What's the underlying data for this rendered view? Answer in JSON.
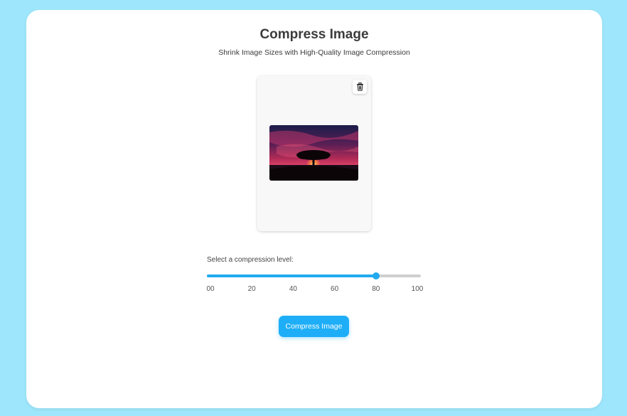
{
  "page": {
    "title": "Compress Image",
    "subtitle": "Shrink Image Sizes with High-Quality Image Compression"
  },
  "preview": {
    "delete_icon": "trash-icon",
    "image_subject": "tree silhouette at sunset"
  },
  "compression": {
    "label": "Select a compression level:",
    "value": 80,
    "min": 0,
    "max": 100,
    "ticks": [
      "00",
      "20",
      "40",
      "60",
      "80",
      "100"
    ],
    "accent_color": "#21aaf0"
  },
  "actions": {
    "compress_label": "Compress Image"
  },
  "colors": {
    "background": "#9ee6fb",
    "card": "#ffffff",
    "button": "#1eaef7"
  }
}
